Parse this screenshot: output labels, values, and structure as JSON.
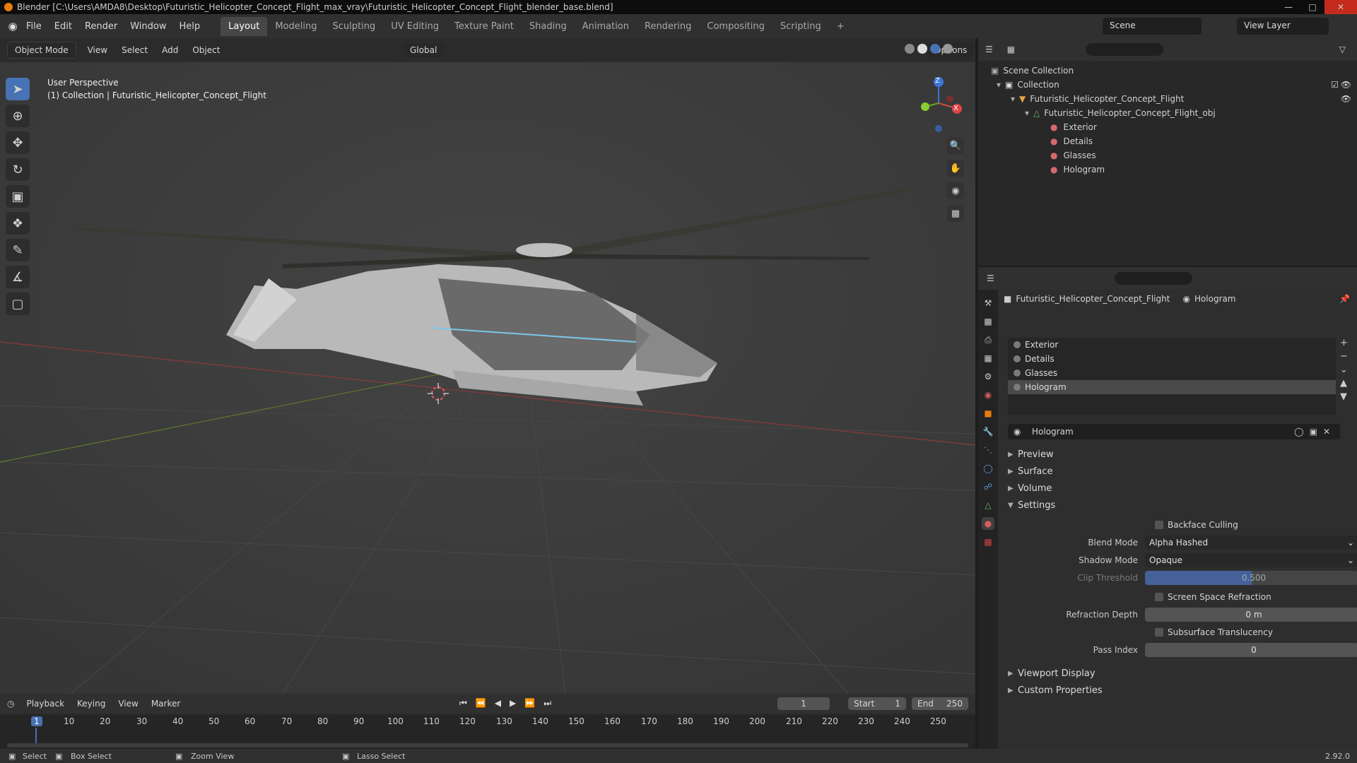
{
  "window": {
    "title": "Blender [C:\\Users\\AMDA8\\Desktop\\Futuristic_Helicopter_Concept_Flight_max_vray\\Futuristic_Helicopter_Concept_Flight_blender_base.blend]"
  },
  "menu": [
    "File",
    "Edit",
    "Render",
    "Window",
    "Help"
  ],
  "workspace_tabs": [
    "Layout",
    "Modeling",
    "Sculpting",
    "UV Editing",
    "Texture Paint",
    "Shading",
    "Animation",
    "Rendering",
    "Compositing",
    "Scripting"
  ],
  "active_tab": "Layout",
  "scene": {
    "name": "Scene",
    "view_layer": "View Layer"
  },
  "viewport": {
    "mode": "Object Mode",
    "menus": [
      "View",
      "Select",
      "Add",
      "Object"
    ],
    "transform_orientation": "Global",
    "options_label": "Options",
    "info_line1": "User Perspective",
    "info_line2": "(1) Collection | Futuristic_Helicopter_Concept_Flight",
    "gizmo": {
      "x": "X",
      "y": "Y",
      "z": "Z"
    }
  },
  "outliner": {
    "root": "Scene Collection",
    "collection": "Collection",
    "object": "Futuristic_Helicopter_Concept_Flight",
    "mesh": "Futuristic_Helicopter_Concept_Flight_obj",
    "materials": [
      "Exterior",
      "Details",
      "Glasses",
      "Hologram"
    ]
  },
  "properties": {
    "breadcrumb_object": "Futuristic_Helicopter_Concept_Flight",
    "breadcrumb_material": "Hologram",
    "material_slots": [
      "Exterior",
      "Details",
      "Glasses",
      "Hologram"
    ],
    "selected_slot": "Hologram",
    "material_name": "Hologram",
    "sections": {
      "preview": "Preview",
      "surface": "Surface",
      "volume": "Volume",
      "settings": "Settings",
      "viewport_display": "Viewport Display",
      "custom_properties": "Custom Properties"
    },
    "settings": {
      "backface_culling": "Backface Culling",
      "blend_mode_label": "Blend Mode",
      "blend_mode": "Alpha Hashed",
      "shadow_mode_label": "Shadow Mode",
      "shadow_mode": "Opaque",
      "clip_threshold_label": "Clip Threshold",
      "clip_threshold": "0.500",
      "screen_space_refraction": "Screen Space Refraction",
      "refraction_depth_label": "Refraction Depth",
      "refraction_depth": "0 m",
      "subsurface_translucency": "Subsurface Translucency",
      "pass_index_label": "Pass Index",
      "pass_index": "0"
    }
  },
  "timeline": {
    "menus": [
      "Playback",
      "Keying",
      "View",
      "Marker"
    ],
    "current_frame": "1",
    "start_label": "Start",
    "start": "1",
    "end_label": "End",
    "end": "250",
    "ticks": [
      "1",
      "10",
      "20",
      "30",
      "40",
      "50",
      "60",
      "70",
      "80",
      "90",
      "100",
      "110",
      "120",
      "130",
      "140",
      "150",
      "160",
      "170",
      "180",
      "190",
      "200",
      "210",
      "220",
      "230",
      "240",
      "250"
    ]
  },
  "statusbar": {
    "select": "Select",
    "box_select": "Box Select",
    "zoom_view": "Zoom View",
    "lasso_select": "Lasso Select",
    "version": "2.92.0"
  }
}
